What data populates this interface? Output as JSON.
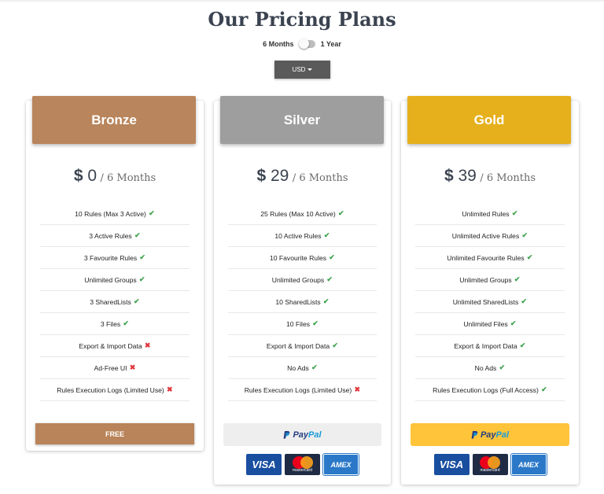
{
  "title": "Our Pricing Plans",
  "toggle": {
    "left_label": "6 Months",
    "right_label": "1 Year",
    "selected": "6 Months"
  },
  "currency": {
    "selected": "USD"
  },
  "colors": {
    "bronze": "#b9855c",
    "silver": "#9e9e9e",
    "gold": "#e5b01c",
    "check": "#3fa34d",
    "cross": "#e0383e"
  },
  "plans": [
    {
      "name": "Bronze",
      "price": "0",
      "currency_symbol": "$",
      "period": "/ 6 Months",
      "features": [
        {
          "text": "10 Rules (Max 3 Active)",
          "included": "✔"
        },
        {
          "text": "3 Active Rules",
          "included": "✔"
        },
        {
          "text": "3 Favourite Rules",
          "included": "✔"
        },
        {
          "text": "Unlimited Groups",
          "included": "✔"
        },
        {
          "text": "3 SharedLists",
          "included": "✔"
        },
        {
          "text": "3 Files",
          "included": "✔"
        },
        {
          "text": "Export & Import Data",
          "included": "✖"
        },
        {
          "text": "Ad-Free UI",
          "included": "✖"
        },
        {
          "text": "Rules Execution Logs (Limited Use)",
          "included": "✖"
        }
      ],
      "button": "FREE"
    },
    {
      "name": "Silver",
      "price": "29",
      "currency_symbol": "$",
      "period": "/ 6 Months",
      "features": [
        {
          "text": "25 Rules (Max 10 Active)",
          "included": "✔"
        },
        {
          "text": "10 Active Rules",
          "included": "✔"
        },
        {
          "text": "10 Favourite Rules",
          "included": "✔"
        },
        {
          "text": "Unlimited Groups",
          "included": "✔"
        },
        {
          "text": "10 SharedLists",
          "included": "✔"
        },
        {
          "text": "10 Files",
          "included": "✔"
        },
        {
          "text": "Export & Import Data",
          "included": "✔"
        },
        {
          "text": "No Ads",
          "included": "✔"
        },
        {
          "text": "Rules Execution Logs (Limited Use)",
          "included": "✖"
        }
      ],
      "paypal": {
        "part1": "Pay",
        "part2": "Pal"
      },
      "cards": {
        "visa": "VISA",
        "mastercard": "mastercard",
        "amex": "AMEX"
      }
    },
    {
      "name": "Gold",
      "price": "39",
      "currency_symbol": "$",
      "period": "/ 6 Months",
      "features": [
        {
          "text": "Unlimited Rules",
          "included": "✔"
        },
        {
          "text": "Unlimited Active Rules",
          "included": "✔"
        },
        {
          "text": "Unlimited Favourite Rules",
          "included": "✔"
        },
        {
          "text": "Unlimited Groups",
          "included": "✔"
        },
        {
          "text": "Unlimited SharedLists",
          "included": "✔"
        },
        {
          "text": "Unlimited Files",
          "included": "✔"
        },
        {
          "text": "Export & Import Data",
          "included": "✔"
        },
        {
          "text": "No Ads",
          "included": "✔"
        },
        {
          "text": "Rules Execution Logs (Full Access)",
          "included": "✔"
        }
      ],
      "paypal": {
        "part1": "Pay",
        "part2": "Pal"
      },
      "cards": {
        "visa": "VISA",
        "mastercard": "mastercard",
        "amex": "AMEX"
      }
    }
  ]
}
